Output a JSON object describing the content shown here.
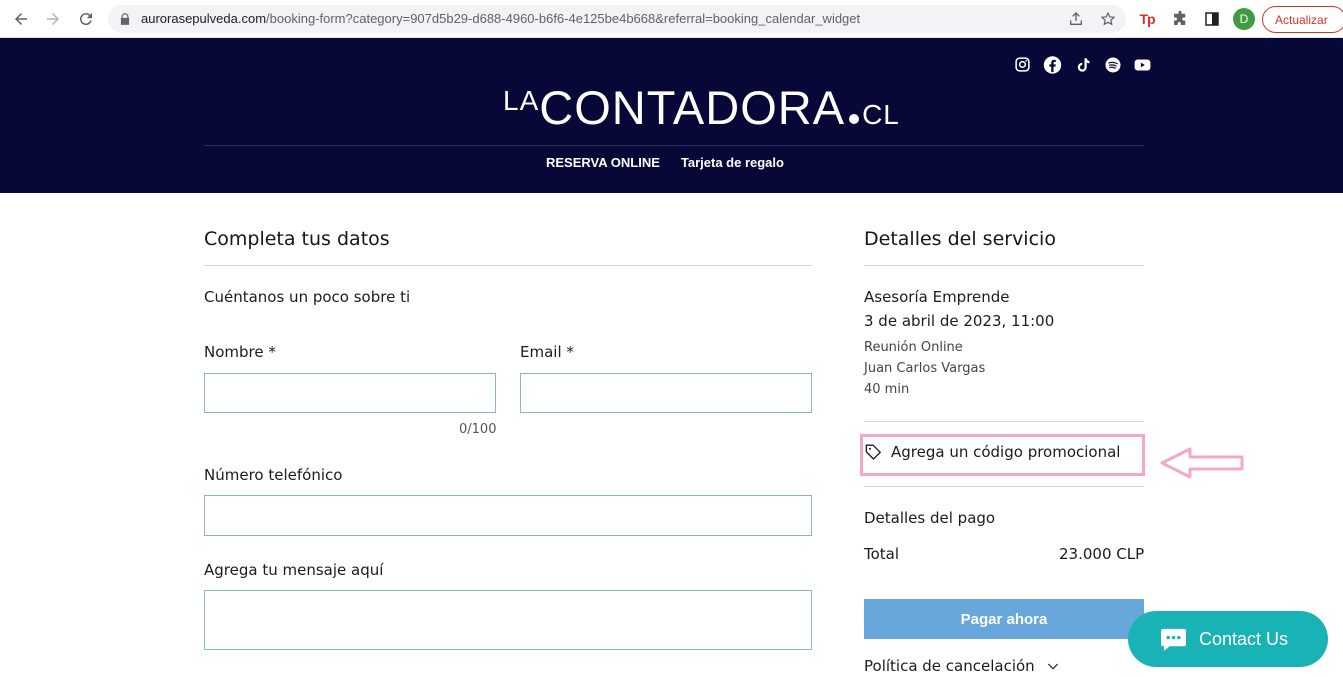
{
  "browser": {
    "url_host": "aurorasepulveda.com",
    "url_path": "/booking-form?category=907d5b29-d688-4960-b6f6-4e125be4b668&referral=booking_calendar_widget",
    "profile_initial": "D",
    "update_label": "Actualizar",
    "ext_tp_label": "Tp"
  },
  "header": {
    "logo_prefix": "LA",
    "logo_main": "CONTADORA",
    "logo_suffix": "CL",
    "menu": [
      "RESERVA ONLINE",
      "Tarjeta de regalo"
    ],
    "socials": [
      "instagram-icon",
      "facebook-icon",
      "tiktok-icon",
      "spotify-icon",
      "youtube-icon"
    ]
  },
  "form": {
    "title": "Completa tus datos",
    "subtitle": "Cuéntanos un poco sobre ti",
    "name_label": "Nombre *",
    "name_value": "",
    "name_counter": "0/100",
    "email_label": "Email *",
    "email_value": "",
    "phone_label": "Número telefónico",
    "phone_value": "",
    "message_label": "Agrega tu mensaje aquí",
    "message_value": ""
  },
  "details": {
    "title": "Detalles del servicio",
    "service": "Asesoría Emprende",
    "datetime": "3 de abril de 2023, 11:00",
    "location": "Reunión Online",
    "staff": "Juan Carlos Vargas",
    "duration": "40 min",
    "promo_label": "Agrega un código promocional",
    "payment_title": "Detalles del pago",
    "total_label": "Total",
    "total_value": "23.000 CLP",
    "pay_button": "Pagar ahora",
    "policy_label": "Política de cancelación"
  },
  "chat": {
    "label": "Contact Us"
  },
  "colors": {
    "header_bg": "#070838",
    "pay_button": "#68a7dc",
    "chat": "#1ab3b5",
    "annotation": "#f2a9c8"
  }
}
